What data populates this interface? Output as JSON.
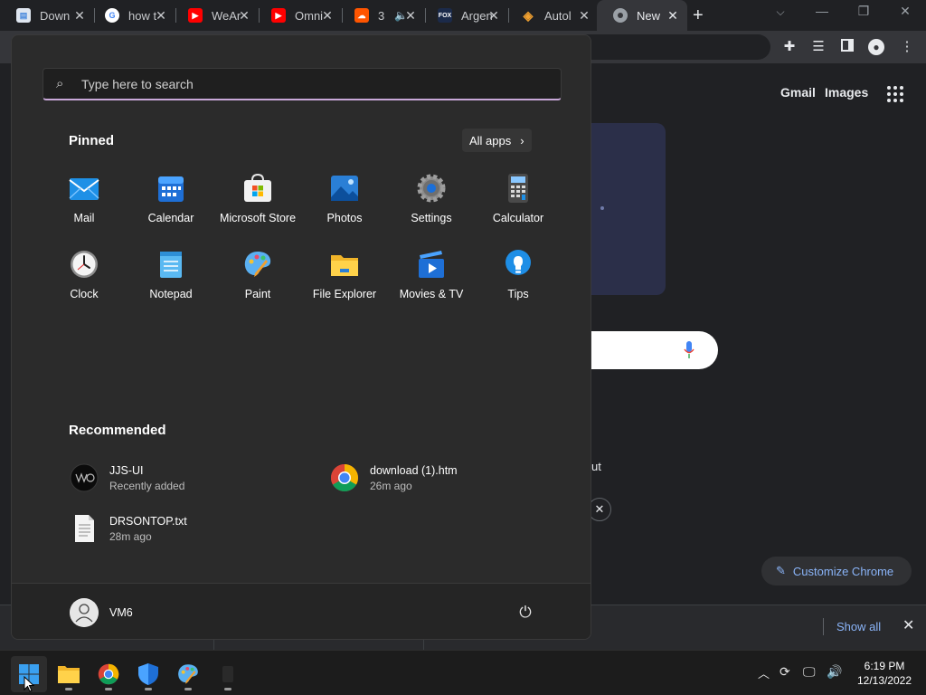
{
  "browser": {
    "tabs": [
      {
        "title": "Down",
        "favicon": "document-icon",
        "color": "#4a89dc"
      },
      {
        "title": "how t",
        "favicon": "google-icon",
        "color": "#ffffff"
      },
      {
        "title": "WeAr",
        "favicon": "youtube-icon",
        "color": "#ff0000"
      },
      {
        "title": "Omni",
        "favicon": "youtube-icon",
        "color": "#ff0000"
      },
      {
        "title": "3",
        "favicon": "soundcloud-icon",
        "color": "#ff5500"
      },
      {
        "title": "Argen",
        "favicon": "fox-icon",
        "color": "#1b2a4a"
      },
      {
        "title": "Autol",
        "favicon": "autodesk-icon",
        "color": "#f0a030"
      },
      {
        "title": "New",
        "favicon": "chrome-icon",
        "color": "#9aa0a6"
      }
    ],
    "ntp": {
      "gmail": "Gmail",
      "images": "Images",
      "partial_text": "ut",
      "customize": "Customize Chrome"
    },
    "downloads": {
      "show_all": "Show all"
    }
  },
  "start_menu": {
    "search_placeholder": "Type here to search",
    "pinned_title": "Pinned",
    "all_apps": "All apps",
    "pinned": [
      {
        "label": "Mail",
        "icon": "mail-icon"
      },
      {
        "label": "Calendar",
        "icon": "calendar-icon"
      },
      {
        "label": "Microsoft Store",
        "icon": "store-icon"
      },
      {
        "label": "Photos",
        "icon": "photos-icon"
      },
      {
        "label": "Settings",
        "icon": "settings-icon"
      },
      {
        "label": "Calculator",
        "icon": "calculator-icon"
      },
      {
        "label": "Clock",
        "icon": "clock-icon"
      },
      {
        "label": "Notepad",
        "icon": "notepad-icon"
      },
      {
        "label": "Paint",
        "icon": "paint-icon"
      },
      {
        "label": "File Explorer",
        "icon": "folder-icon"
      },
      {
        "label": "Movies & TV",
        "icon": "movies-icon"
      },
      {
        "label": "Tips",
        "icon": "tips-icon"
      }
    ],
    "recommended_title": "Recommended",
    "recommended": [
      {
        "name": "JJS-UI",
        "sub": "Recently added",
        "icon": "app-logo-icon"
      },
      {
        "name": "download (1).htm",
        "sub": "26m ago",
        "icon": "chrome-icon"
      },
      {
        "name": "DRSONTOP.txt",
        "sub": "28m ago",
        "icon": "text-file-icon"
      }
    ],
    "user": "VM6"
  },
  "taskbar": {
    "time": "6:19 PM",
    "date": "12/13/2022"
  }
}
